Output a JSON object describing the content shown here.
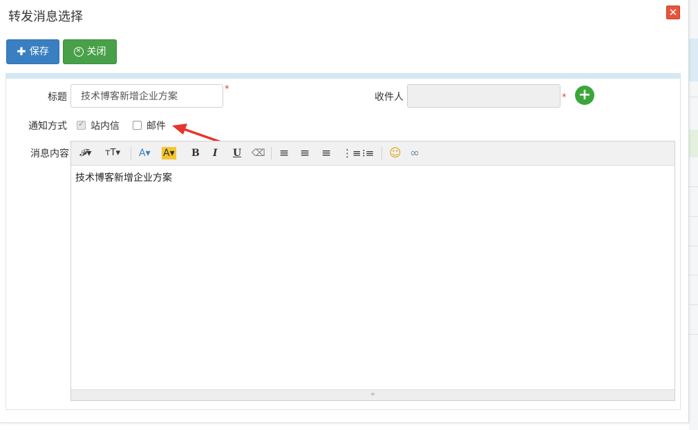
{
  "dialog": {
    "title": "转发消息选择",
    "close_glyph": "✕"
  },
  "toolbar_buttons": {
    "save_label": "保存",
    "close_label": "关闭"
  },
  "form": {
    "title_label": "标题",
    "title_value": "技术博客新增企业方案",
    "recipient_label": "收件人",
    "recipient_value": "",
    "required_mark": "*",
    "notify_label": "通知方式",
    "notify_options": [
      {
        "label": "站内信",
        "checked": true,
        "disabled": true
      },
      {
        "label": "邮件",
        "checked": false,
        "disabled": false
      }
    ],
    "content_label": "消息内容"
  },
  "editor": {
    "tools": [
      {
        "name": "font-family-icon",
        "glyph": "𝓕▾"
      },
      {
        "name": "font-size-icon",
        "glyph": "ᴛT▾"
      },
      {
        "name": "font-color-icon",
        "glyph": "A▾"
      },
      {
        "name": "highlight-color-icon",
        "glyph": "A▾"
      },
      {
        "name": "bold-icon",
        "glyph": "B"
      },
      {
        "name": "italic-icon",
        "glyph": "I"
      },
      {
        "name": "underline-icon",
        "glyph": "U"
      },
      {
        "name": "eraser-icon",
        "glyph": "⌫"
      },
      {
        "name": "align-left-icon",
        "glyph": "≡"
      },
      {
        "name": "align-center-icon",
        "glyph": "≡"
      },
      {
        "name": "align-right-icon",
        "glyph": "≡"
      },
      {
        "name": "ordered-list-icon",
        "glyph": "⋮≡"
      },
      {
        "name": "unordered-list-icon",
        "glyph": "⁝≡"
      },
      {
        "name": "emoji-icon",
        "glyph": "☺"
      },
      {
        "name": "link-icon",
        "glyph": "∞"
      }
    ],
    "content": "技术博客新增企业方案"
  },
  "colors": {
    "save_button": "#3a7fc1",
    "close_button": "#48a048",
    "close_x": "#e8543b",
    "add_button": "#3aa63a",
    "required": "#e03a3a",
    "arrow": "#e8332a",
    "highlight": "#f6c52c",
    "font_color": "#3a7fc1"
  }
}
